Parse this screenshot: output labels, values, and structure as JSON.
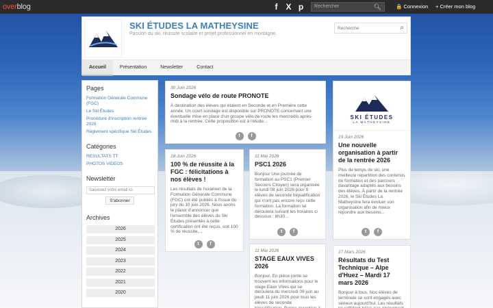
{
  "topbar": {
    "logo_over": "over",
    "logo_blog": "blog",
    "socials": [
      "f",
      "X",
      "p"
    ],
    "search_placeholder": "Rechercher",
    "login": "🔒 Connexion",
    "create": "+ Créer mon blog"
  },
  "header": {
    "title": "SKI ÉTUDES LA MATHEYSINE",
    "subtitle": "Passion du ski, réussite scolaire et projet professionnel en montagne.",
    "search_placeholder": "Recherche",
    "nav": [
      "Accueil",
      "Présentation",
      "Newsletter",
      "Contact"
    ]
  },
  "sidebar": {
    "pages_heading": "Pages",
    "pages": [
      "Formation Générale Commune (FGC)",
      "Le Ski Études",
      "Procédure d'inscription rentrée 2026",
      "Règlement spécifique Ski Études"
    ],
    "categories_heading": "Catégories",
    "categories": [
      "RESULTATS TT",
      "PHOTOS VIDEOS"
    ],
    "newsletter_heading": "Newsletter",
    "newsletter_placeholder": "Saisissez votre email ici",
    "newsletter_button": "S'abonner",
    "archives_heading": "Archives",
    "archives": [
      "2026",
      "2025",
      "2024",
      "2023",
      "2022",
      "2021",
      "2020"
    ]
  },
  "posts": [
    {
      "date": "30 Juin 2026",
      "title": "Sondage vélo de route PRONOTE",
      "excerpt": "À destination des élèves qui étaient en Seconde et en Première cette année. Un court sondage est disponible sur PRONOTE concernant une éventuelle mise en place d'un groupe vélo de route les mercredis après-midi à la rentrée. Cette proposition est à l'étude..."
    },
    {
      "date": "18 Juin 2026",
      "title": "100 % de réussite à la FGC : félicitations à nos élèves !",
      "excerpt": "Les résultats de l'examen de la Formation Générale Commune (FGC) ont été publiés à l'issue du jury du 10 juin 2026. Nous avons le plaisir d'annoncer que l'ensemble des élèves du Ski Études présentés à cette certification ont été reçus, soit 100 % de réussite,..."
    },
    {
      "date": "11 Mai 2026",
      "title": "PSC1 2026",
      "excerpt": "Bonjour Une journée de formation au PSC1 (Premier Secours Citoyen) sera organisée le lundi 08 juin 2026 pour 9 élèves de seconde biqualification qui n'ont pas encore reçu cette formation. La formation se déroulera suivant les horaires ci dessous : 8h30..."
    },
    {
      "date": "19 Juin 2026",
      "title": "Une nouvelle organisation à partir de la rentrée 2026",
      "excerpt": "Plus de temps de ski, une meilleure répartition des contenus de formation et des parcours davantage adaptés aux besoins des élèves. À partir de la rentrée 2026, le Ski Études La Matheysine fera évoluer son organisation afin de mieux répondre aux besoins..."
    },
    {
      "date": "11 Mai 2026",
      "title": "STAGE EAUX VIVES 2026",
      "excerpt": "Bonjour, En pièce jointe se trouvent les informations pour le stage Eaux Vives qui se déroulera du mercredi 09 juin au jeudi 11 juin 2026 pour tous les élèves de seconde biqualification. Bonne réception à tous"
    },
    {
      "date": "17 Mars 2026",
      "title": "Résultats du Test Technique – Alpe d'Huez – Mardi 17 mars 2026",
      "excerpt": "Bonjour à tous, Nos élèves de terminale se sont engagés avec sérieux aujourd'hui. Les résultats ne reflètent hélas pas pleinement les progrès..."
    }
  ],
  "brand": {
    "name": "SKI ÉTUDES",
    "sub": "LA MATHEYSINE"
  },
  "share": {
    "twitter": "t",
    "facebook": "f"
  },
  "colors": {
    "accent": "#3b7fb8",
    "topbar": "#2b2b2b",
    "logo_over": "#e8553f",
    "brand": "#1f2b57"
  }
}
